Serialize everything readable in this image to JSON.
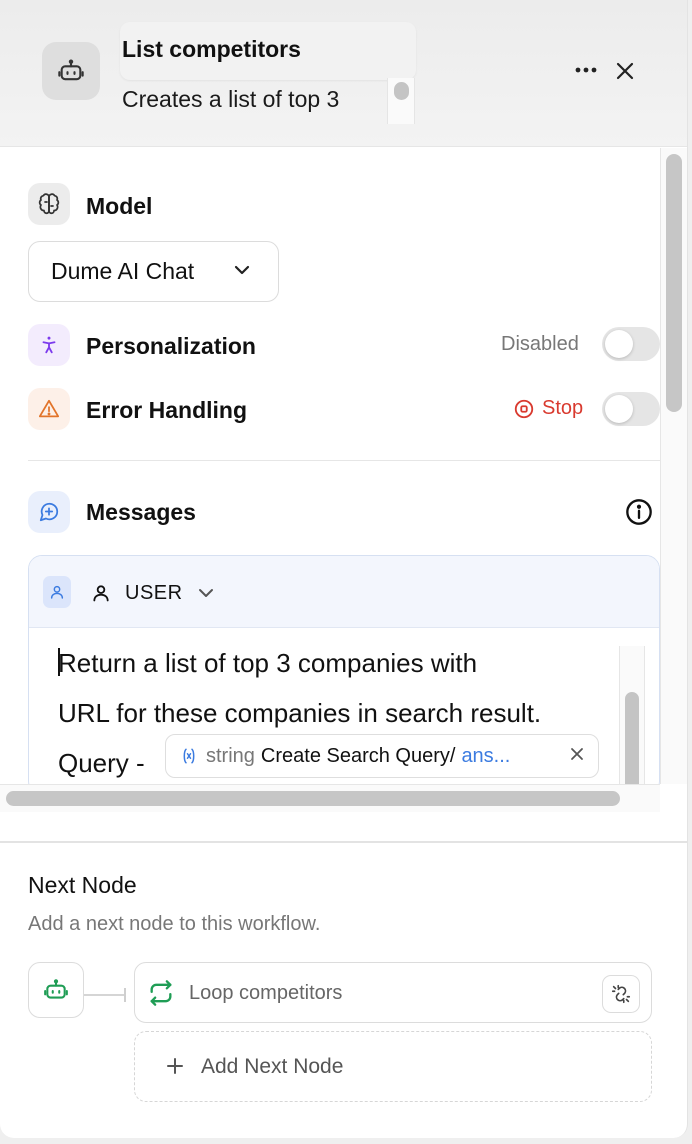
{
  "header": {
    "title": "List competitors",
    "description": "Creates a list of top 3",
    "node_icon": "robot-icon",
    "more_icon": "more-horizontal-icon",
    "close_icon": "close-icon"
  },
  "model": {
    "label": "Model",
    "icon": "brain-icon",
    "selected": "Dume AI Chat"
  },
  "personalization": {
    "label": "Personalization",
    "icon": "accessibility-icon",
    "status": "Disabled",
    "enabled": false
  },
  "error_handling": {
    "label": "Error Handling",
    "icon": "warning-icon",
    "status": "Stop",
    "status_color": "#d93a2f",
    "enabled": false
  },
  "messages": {
    "label": "Messages",
    "icon": "message-plus-icon",
    "info_icon": "info-icon",
    "items": [
      {
        "role": "USER",
        "lines": [
          "Return a list of top 3 companies with",
          "URL for these companies in search result.",
          "Query - "
        ],
        "variable": {
          "type": "string",
          "path": "Create Search Query/",
          "field": "ans..."
        }
      }
    ]
  },
  "next_node": {
    "title": "Next Node",
    "subtitle": "Add a next node to this workflow.",
    "linked": {
      "label": "Loop competitors",
      "icon": "loop-icon"
    },
    "add_label": "Add Next Node"
  },
  "colors": {
    "accent_blue": "#3b7be0",
    "purple": "#7c3aed",
    "orange": "#e2742a",
    "green": "#1f9d55",
    "red": "#d93a2f"
  }
}
